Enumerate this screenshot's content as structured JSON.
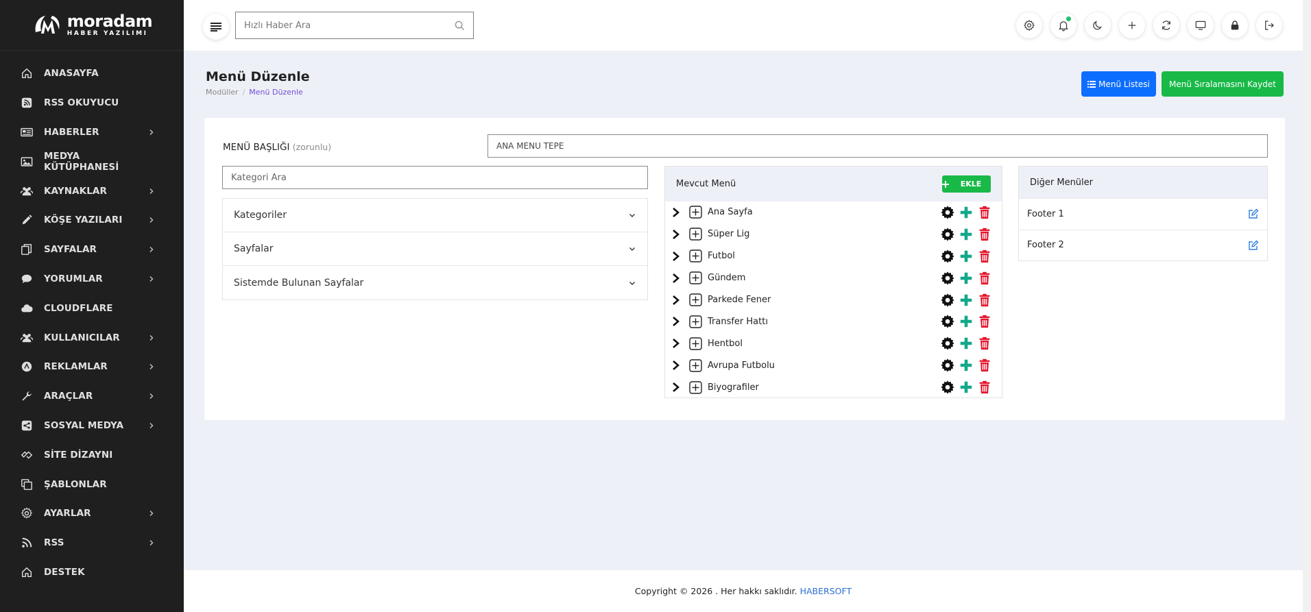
{
  "brand": {
    "name": "moradam",
    "subtitle": "HABER YAZILIMI"
  },
  "sidebar": {
    "items": [
      {
        "label": "ANASAYFA",
        "icon": "home-icon",
        "has_children": false
      },
      {
        "label": "RSS OKUYUCU",
        "icon": "rss-square-icon",
        "has_children": false
      },
      {
        "label": "HABERLER",
        "icon": "newspaper-icon",
        "has_children": true
      },
      {
        "label": "MEDYA KÜTÜPHANESİ",
        "icon": "image-icon",
        "has_children": false
      },
      {
        "label": "KAYNAKLAR",
        "icon": "users-icon",
        "has_children": true
      },
      {
        "label": "KÖŞE YAZILARI",
        "icon": "pen-icon",
        "has_children": true
      },
      {
        "label": "SAYFALAR",
        "icon": "pages-icon",
        "has_children": true
      },
      {
        "label": "YORUMLAR",
        "icon": "comment-icon",
        "has_children": true
      },
      {
        "label": "CLOUDFLARE",
        "icon": "cloud-icon",
        "has_children": false
      },
      {
        "label": "KULLANICILAR",
        "icon": "users-icon",
        "has_children": true
      },
      {
        "label": "REKLAMLAR",
        "icon": "ads-icon",
        "has_children": true
      },
      {
        "label": "ARAÇLAR",
        "icon": "wrench-icon",
        "has_children": true
      },
      {
        "label": "SOSYAL MEDYA",
        "icon": "share-icon",
        "has_children": true
      },
      {
        "label": "SİTE DİZAYNI",
        "icon": "design-icon",
        "has_children": false
      },
      {
        "label": "ŞABLONLAR",
        "icon": "copy-icon",
        "has_children": false
      },
      {
        "label": "AYARLAR",
        "icon": "gear-icon",
        "has_children": true
      },
      {
        "label": "RSS",
        "icon": "rss-icon",
        "has_children": true
      },
      {
        "label": "DESTEK",
        "icon": "home-icon",
        "has_children": false
      }
    ]
  },
  "header": {
    "search_placeholder": "Hızlı Haber Ara"
  },
  "page": {
    "title": "Menü Düzenle",
    "breadcrumb": [
      "Modüller",
      "Menü Düzenle"
    ],
    "btn_list": "Menü Listesi",
    "btn_save": "Menü Sıralamasını Kaydet"
  },
  "form": {
    "title_label": "MENÜ BAŞLIĞI",
    "title_required": "(zorunlu)",
    "title_value": "ANA MENU TEPE",
    "category_search_placeholder": "Kategori Ara"
  },
  "accordion": [
    "Kategoriler",
    "Sayfalar",
    "Sistemde Bulunan Sayfalar"
  ],
  "current_menu": {
    "title": "Mevcut Menü",
    "add_label": "EKLE",
    "items": [
      "Ana Sayfa",
      "Süper Lig",
      "Futbol",
      "Gündem",
      "Parkede Fener",
      "Transfer Hattı",
      "Hentbol",
      "Avrupa Futbolu",
      "Biyografiler"
    ]
  },
  "other_menus": {
    "title": "Diğer Menüler",
    "items": [
      "Footer 1",
      "Footer 2"
    ]
  },
  "footer": {
    "text": "Copyright © 2026 . Her hakkı saklıdır.",
    "brand": "HABERSOFT"
  },
  "colors": {
    "sidebar_bg": "#1f1f1f",
    "primary": "#0d6efd",
    "success": "#19b948",
    "danger": "#e4152d",
    "teal": "#12a88a"
  }
}
